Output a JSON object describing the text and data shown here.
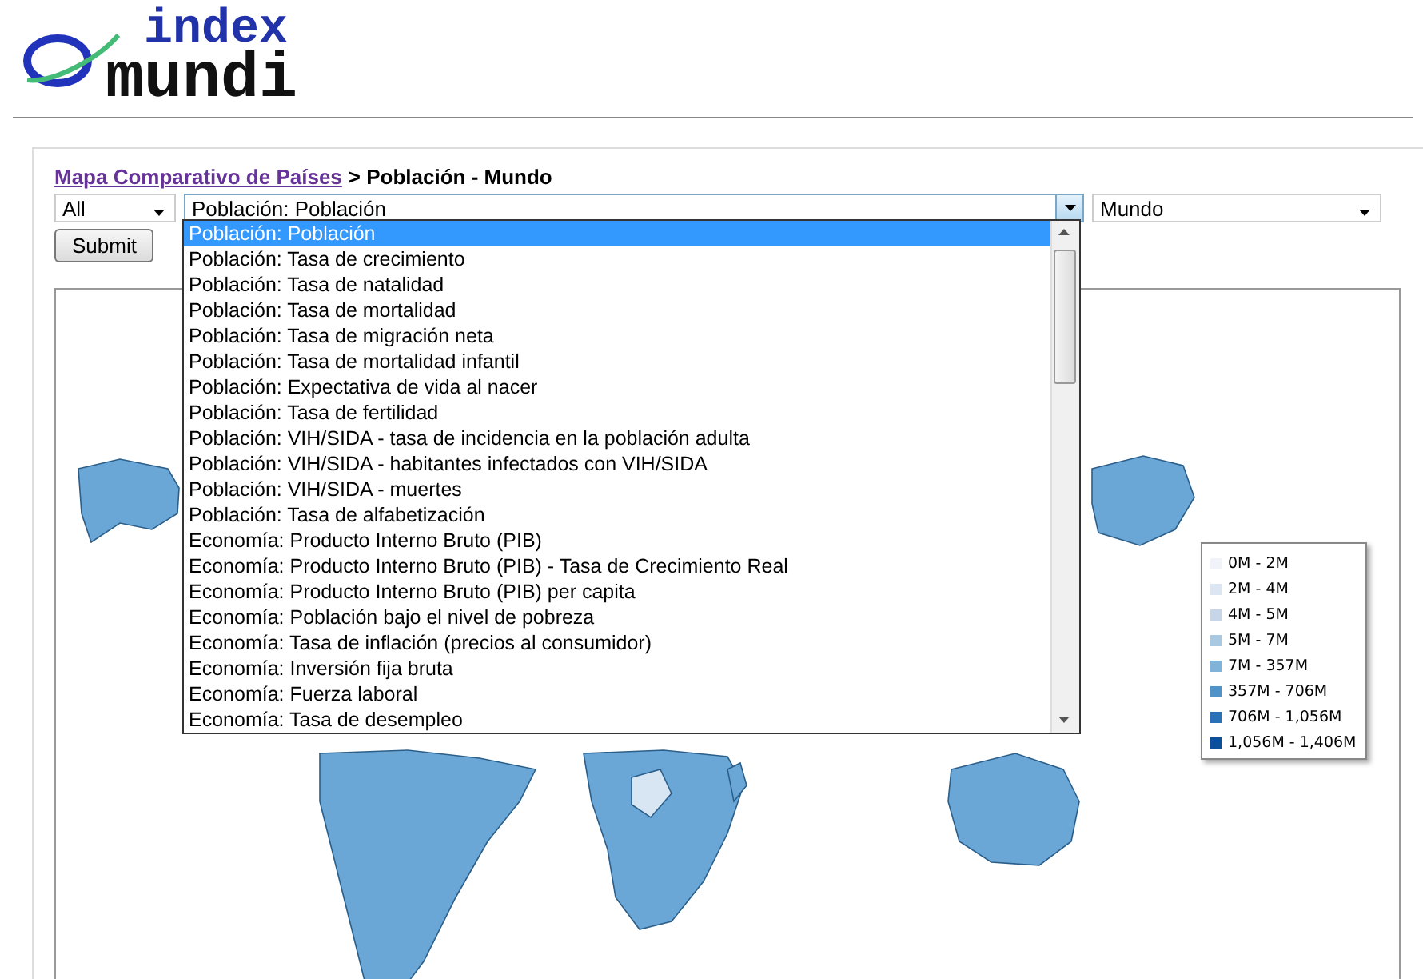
{
  "logo": {
    "top": "index",
    "bottom": "mundi"
  },
  "breadcrumb": {
    "link": "Mapa Comparativo de Países",
    "title": "> Población - Mundo"
  },
  "filters": {
    "region_group": "All",
    "indicator": "Población: Población",
    "region": "Mundo"
  },
  "submit": "Submit",
  "indicator_options": [
    {
      "label": "Población: Población",
      "selected": true
    },
    {
      "label": "Población: Tasa de crecimiento",
      "selected": false
    },
    {
      "label": "Población: Tasa de natalidad",
      "selected": false
    },
    {
      "label": "Población: Tasa de mortalidad",
      "selected": false
    },
    {
      "label": "Población: Tasa de migración neta",
      "selected": false
    },
    {
      "label": "Población: Tasa de mortalidad infantil",
      "selected": false
    },
    {
      "label": "Población: Expectativa de vida al nacer",
      "selected": false
    },
    {
      "label": "Población: Tasa de fertilidad",
      "selected": false
    },
    {
      "label": "Población: VIH/SIDA - tasa de incidencia en la población adulta",
      "selected": false
    },
    {
      "label": "Población: VIH/SIDA - habitantes infectados con VIH/SIDA",
      "selected": false
    },
    {
      "label": "Población: VIH/SIDA - muertes",
      "selected": false
    },
    {
      "label": "Población: Tasa de alfabetización",
      "selected": false
    },
    {
      "label": "Economía: Producto Interno Bruto (PIB)",
      "selected": false
    },
    {
      "label": "Economía: Producto Interno Bruto (PIB) - Tasa de Crecimiento Real",
      "selected": false
    },
    {
      "label": "Economía: Producto Interno Bruto (PIB) per capita",
      "selected": false
    },
    {
      "label": "Economía: Población bajo el nivel de pobreza",
      "selected": false
    },
    {
      "label": "Economía: Tasa de inflación (precios al consumidor)",
      "selected": false
    },
    {
      "label": "Economía: Inversión fija bruta",
      "selected": false
    },
    {
      "label": "Economía: Fuerza laboral",
      "selected": false
    },
    {
      "label": "Economía: Tasa de desempleo",
      "selected": false
    }
  ],
  "legend": [
    {
      "label": "0M - 2M",
      "color": "#f0f4fa"
    },
    {
      "label": "2M - 4M",
      "color": "#dce6f2"
    },
    {
      "label": "4M - 5M",
      "color": "#c6d5e8"
    },
    {
      "label": "5M - 7M",
      "color": "#a9c9e3"
    },
    {
      "label": "7M - 357M",
      "color": "#7fb3da"
    },
    {
      "label": "357M - 706M",
      "color": "#4f93c8"
    },
    {
      "label": "706M - 1,056M",
      "color": "#2a72b8"
    },
    {
      "label": "1,056M - 1,406M",
      "color": "#0c4f9a"
    }
  ]
}
